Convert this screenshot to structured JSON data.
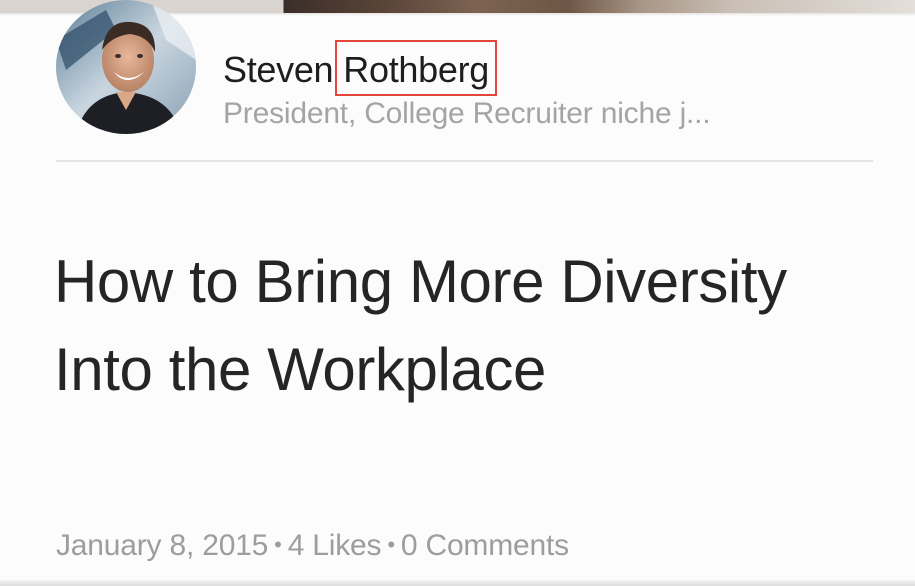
{
  "author": {
    "first_name": "Steven",
    "last_name": "Rothberg",
    "headline": "President, College Recruiter niche j..."
  },
  "article": {
    "title": "How to Bring More Diversity Into the Workplace"
  },
  "meta": {
    "date": "January 8, 2015",
    "separator": "•",
    "likes": "4 Likes",
    "comments": "0 Comments"
  },
  "icons": {
    "avatar": "profile-photo"
  },
  "colors": {
    "highlight_box": "#e0463c",
    "title_text": "#252525",
    "secondary_text": "#a4a4a4"
  }
}
